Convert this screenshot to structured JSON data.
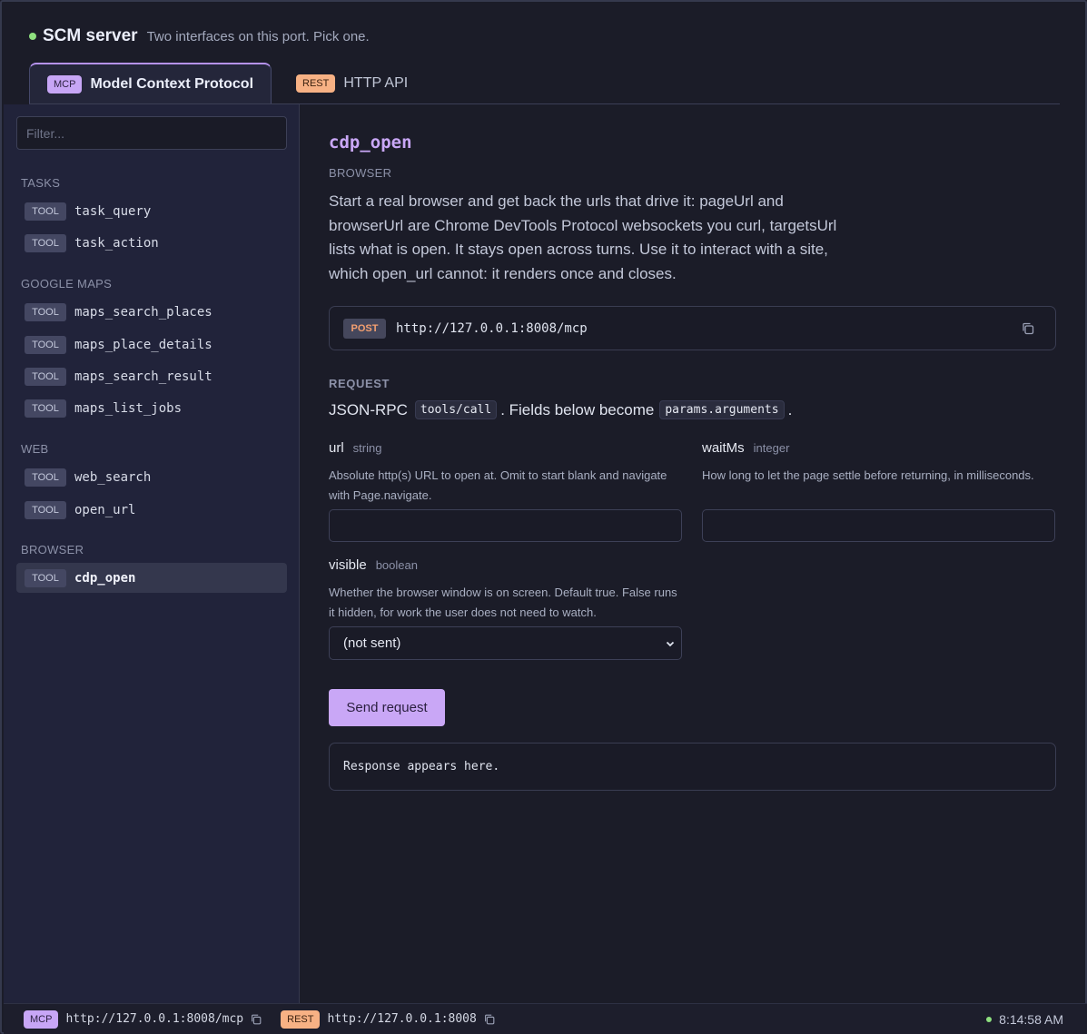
{
  "header": {
    "title": "SCM server",
    "subtitle": "Two interfaces on this port. Pick one.",
    "status_color": "#8ee07f"
  },
  "tabs": [
    {
      "badge": "MCP",
      "label": "Model Context Protocol",
      "active": true
    },
    {
      "badge": "REST",
      "label": "HTTP API",
      "active": false
    }
  ],
  "sidebar": {
    "filter_placeholder": "Filter...",
    "tool_badge": "TOOL",
    "sections": [
      {
        "label": "TASKS",
        "items": [
          "task_query",
          "task_action"
        ]
      },
      {
        "label": "GOOGLE MAPS",
        "items": [
          "maps_search_places",
          "maps_place_details",
          "maps_search_result",
          "maps_list_jobs"
        ]
      },
      {
        "label": "WEB",
        "items": [
          "web_search",
          "open_url"
        ]
      },
      {
        "label": "BROWSER",
        "items": [
          "cdp_open"
        ]
      }
    ],
    "selected": "cdp_open"
  },
  "main": {
    "title": "cdp_open",
    "category": "BROWSER",
    "description": "Start a real browser and get back the urls that drive it: pageUrl and browserUrl are Chrome DevTools Protocol websockets you curl, targetsUrl lists what is open. It stays open across turns. Use it to interact with a site, which open_url cannot: it renders once and closes.",
    "endpoint": {
      "method": "POST",
      "url": "http://127.0.0.1:8008/mcp"
    },
    "request": {
      "heading": "REQUEST",
      "prefix": "JSON-RPC",
      "method_code": "tools/call",
      "middle": ". Fields below become",
      "params_code": "params.arguments",
      "suffix": "."
    },
    "fields": {
      "url": {
        "name": "url",
        "type": "string",
        "help": "Absolute http(s) URL to open at. Omit to start blank and navigate with Page.navigate.",
        "value": ""
      },
      "waitMs": {
        "name": "waitMs",
        "type": "integer",
        "help": "How long to let the page settle before returning, in milliseconds.",
        "value": ""
      },
      "visible": {
        "name": "visible",
        "type": "boolean",
        "help": "Whether the browser window is on screen. Default true. False runs it hidden, for work the user does not need to watch.",
        "selected": "(not sent)"
      }
    },
    "send_label": "Send request",
    "response_placeholder": "Response appears here."
  },
  "footer": {
    "mcp_badge": "MCP",
    "mcp_url": "http://127.0.0.1:8008/mcp",
    "rest_badge": "REST",
    "rest_url": "http://127.0.0.1:8008",
    "time": "8:14:58 AM"
  },
  "colors": {
    "accent": "#c9a7f6",
    "rest_accent": "#f7b184",
    "background": "#1b1c28",
    "sidebar": "#21233a"
  }
}
